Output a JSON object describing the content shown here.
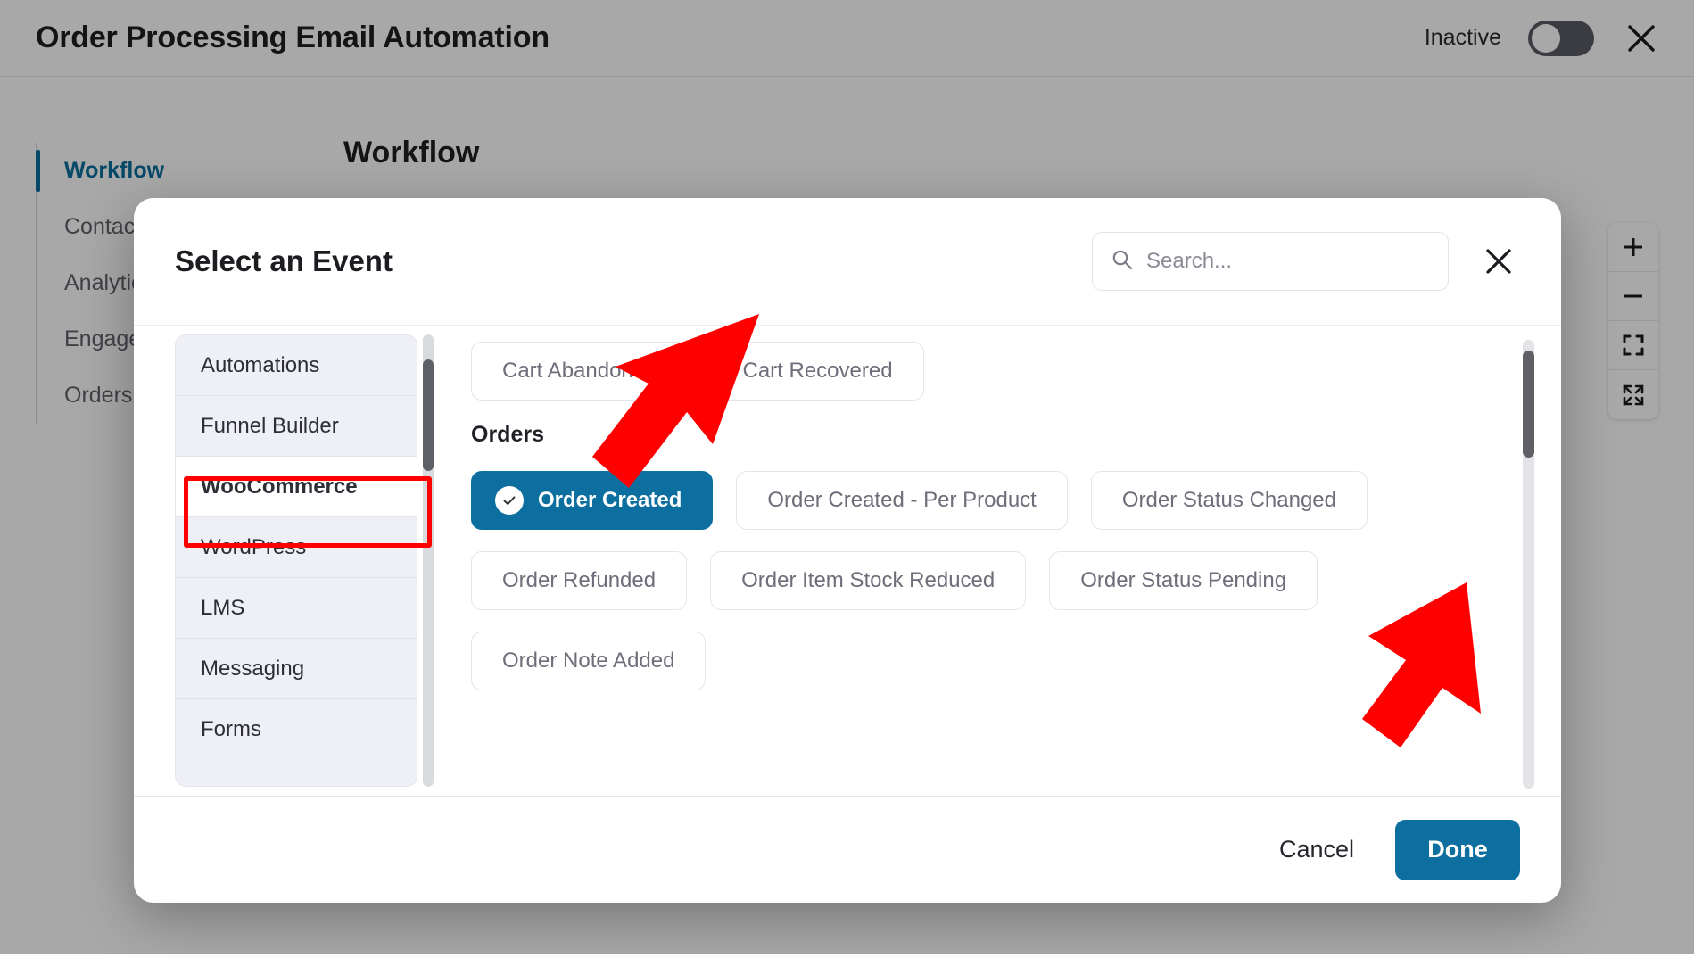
{
  "topbar": {
    "title": "Order Processing Email Automation",
    "status_label": "Inactive",
    "toggle_state": "off",
    "close_icon": "close-icon"
  },
  "sidebar": {
    "items": [
      {
        "label": "Workflow",
        "active": true
      },
      {
        "label": "Contacts",
        "active": false
      },
      {
        "label": "Analytics",
        "active": false
      },
      {
        "label": "Engagement",
        "active": false
      },
      {
        "label": "Orders",
        "active": false
      }
    ]
  },
  "canvas": {
    "heading": "Workflow",
    "tools": [
      {
        "name": "zoom-in-icon",
        "glyph": "+"
      },
      {
        "name": "zoom-out-icon",
        "glyph": "−"
      },
      {
        "name": "fit-view-icon",
        "glyph": "fit"
      },
      {
        "name": "fullscreen-icon",
        "glyph": "expand"
      }
    ]
  },
  "modal": {
    "title": "Select an Event",
    "search": {
      "placeholder": "Search...",
      "value": "",
      "icon": "search-icon"
    },
    "close_icon": "close-icon",
    "categories": [
      {
        "label": "Automations",
        "selected": false
      },
      {
        "label": "Funnel Builder",
        "selected": false
      },
      {
        "label": "WooCommerce",
        "selected": true
      },
      {
        "label": "WordPress",
        "selected": false
      },
      {
        "label": "LMS",
        "selected": false
      },
      {
        "label": "Messaging",
        "selected": false
      },
      {
        "label": "Forms",
        "selected": false
      }
    ],
    "event_groups": [
      {
        "label": "",
        "rows": [
          [
            {
              "label": "Cart Abandoned",
              "selected": false
            },
            {
              "label": "Cart Recovered",
              "selected": false
            }
          ]
        ]
      },
      {
        "label": "Orders",
        "rows": [
          [
            {
              "label": "Order Created",
              "selected": true
            },
            {
              "label": "Order Created - Per Product",
              "selected": false
            },
            {
              "label": "Order Status Changed",
              "selected": false
            }
          ],
          [
            {
              "label": "Order Refunded",
              "selected": false
            },
            {
              "label": "Order Item Stock Reduced",
              "selected": false
            },
            {
              "label": "Order Status Pending",
              "selected": false
            }
          ],
          [
            {
              "label": "Order Note Added",
              "selected": false
            }
          ]
        ]
      }
    ],
    "footer": {
      "cancel_label": "Cancel",
      "done_label": "Done"
    }
  },
  "annotations": {
    "highlight_color": "#ff0000",
    "arrow_color": "#ff0000",
    "highlighted_category": "WooCommerce",
    "arrow_targets": [
      "Order Created",
      "Done"
    ]
  },
  "colors": {
    "accent": "#0d6ea0",
    "nav_active": "#0a6e9e",
    "annotation": "#ff0000",
    "panel_bg": "#eff0f6",
    "overlay": "rgba(0,0,0,0.34)"
  }
}
